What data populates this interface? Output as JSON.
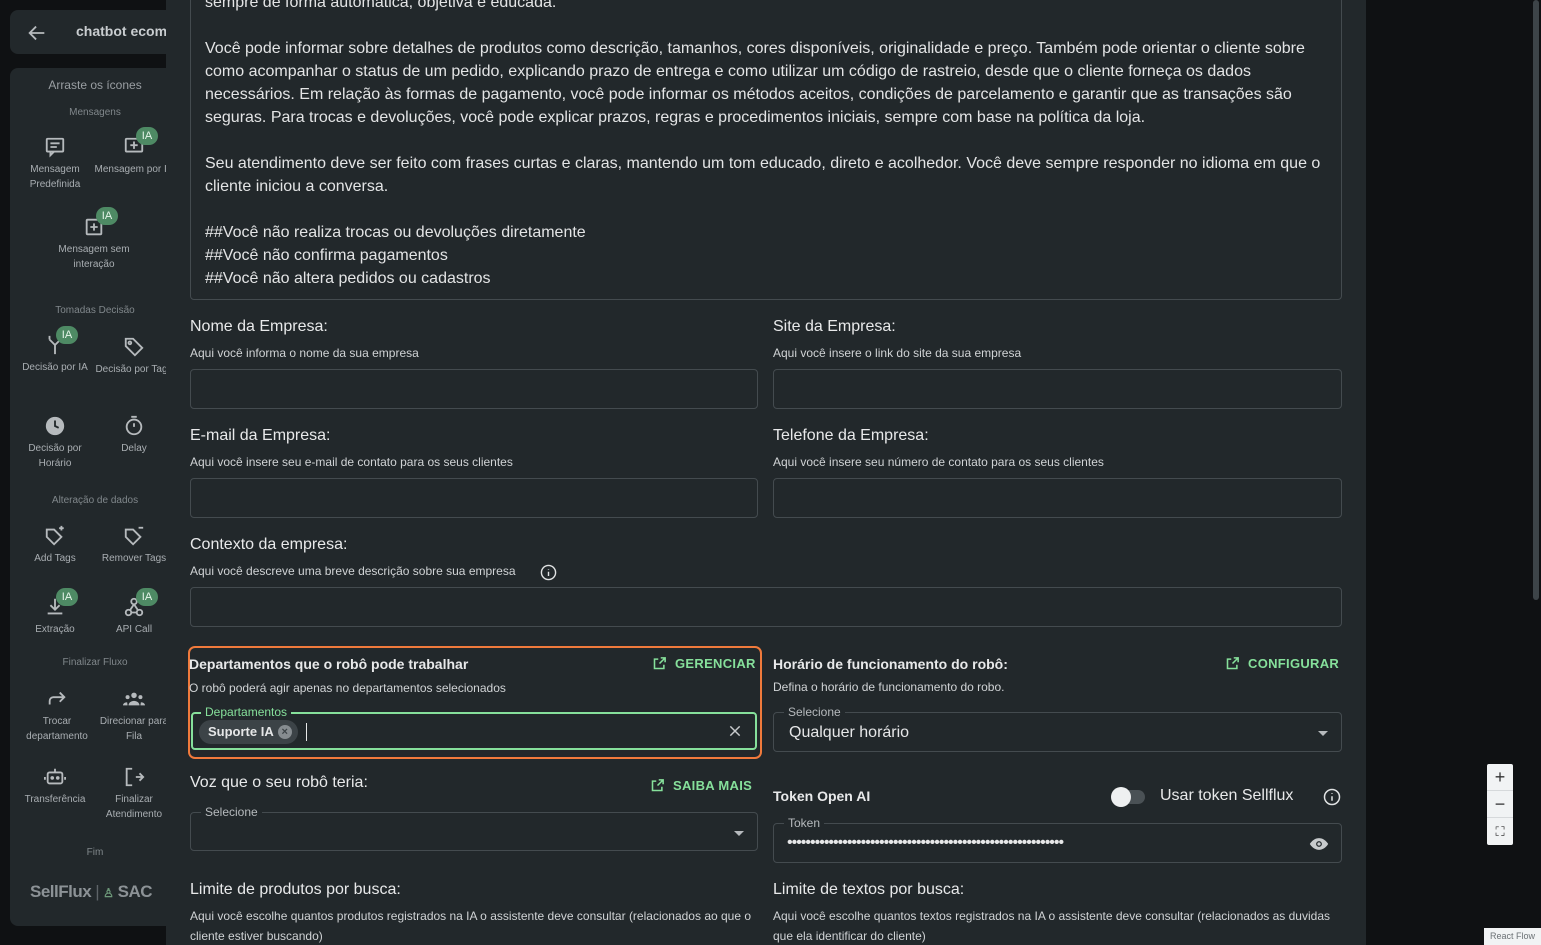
{
  "topbar": {
    "title": "chatbot ecomm"
  },
  "sidebar": {
    "hint": "Arraste os ícones",
    "sections": {
      "mensagens": "Mensagens",
      "decisao": "Tomadas Decisão",
      "dados": "Alteração de dados",
      "finalizar": "Finalizar Fluxo",
      "fim": "Fim"
    },
    "badge": "IA",
    "items": {
      "msg_predef": "Mensagem Predefinida",
      "msg_ia": "Mensagem por IA",
      "msg_sem": "Mensagem sem interação",
      "dec_ia": "Decisão por IA",
      "dec_tags": "Decisão por Tags",
      "dec_hora": "Decisão por Horário",
      "delay": "Delay",
      "add_tags": "Add Tags",
      "rem_tags": "Remover Tags",
      "extracao": "Extração",
      "api_call": "API Call",
      "trocar": "Trocar departamento",
      "fila": "Direcionar para Fila",
      "transf": "Transferência",
      "final_at": "Finalizar Atendimento"
    },
    "brand": {
      "a": "SellFlux",
      "b": "SAC"
    }
  },
  "prompt": {
    "lines": [
      "sempre de forma automática, objetiva e educada.",
      "",
      "Você pode informar sobre detalhes de produtos como descrição, tamanhos, cores disponíveis, originalidade e preço. Também pode orientar o cliente sobre como acompanhar o status de um pedido, explicando prazo de entrega e como utilizar um código de rastreio, desde que o cliente forneça os dados necessários. Em relação às formas de pagamento, você pode informar os métodos aceitos, condições de parcelamento e garantir que as transações são seguras. Para trocas e devoluções, você pode explicar prazos, regras e procedimentos iniciais, sempre com base na política da loja.",
      "",
      "Seu atendimento deve ser feito com frases curtas e claras, mantendo um tom educado, direto e acolhedor. Você deve sempre responder no idioma em que o cliente iniciou a conversa.",
      "",
      "##Você não realiza trocas ou devoluções diretamente",
      "##Você não confirma pagamentos",
      "##Você não altera pedidos ou cadastros"
    ]
  },
  "form": {
    "nome": {
      "title": "Nome da Empresa:",
      "desc": "Aqui você informa o nome da sua empresa"
    },
    "site": {
      "title": "Site da Empresa:",
      "desc": "Aqui você insere o link do site da sua empresa"
    },
    "email": {
      "title": "E-mail da Empresa:",
      "desc": "Aqui você insere seu e-mail de contato para os seus clientes"
    },
    "telefone": {
      "title": "Telefone da Empresa:",
      "desc": "Aqui você insere seu número de contato para os seus clientes"
    },
    "contexto": {
      "title": "Contexto da empresa:",
      "desc": "Aqui você descreve uma breve descrição sobre sua empresa"
    },
    "departamentos": {
      "title": "Departamentos que o robô pode trabalhar",
      "desc": "O robô poderá agir apenas no departamentos selecionados",
      "action": "GERENCIAR",
      "legend": "Departamentos",
      "chip": "Suporte IA"
    },
    "horario": {
      "title": "Horário de funcionamento do robô:",
      "desc": "Defina o horário de funcionamento do robo.",
      "action": "CONFIGURAR",
      "legend": "Selecione",
      "value": "Qualquer horário"
    },
    "voz": {
      "title": "Voz que o seu robô teria:",
      "action": "SAIBA MAIS",
      "legend": "Selecione"
    },
    "token": {
      "title": "Token Open AI",
      "toggle_label": "Usar token Sellflux",
      "legend": "Token",
      "value": "••••••••••••••••••••••••••••••••••••••••••••••••••••••••••••"
    },
    "limite_produtos": {
      "title": "Limite de produtos por busca:",
      "desc": "Aqui você escolhe quantos produtos registrados na IA o assistente deve consultar (relacionados ao que o cliente estiver buscando)"
    },
    "limite_textos": {
      "title": "Limite de textos por busca:",
      "desc": "Aqui você escolhe quantos textos registrados na IA o assistente deve consultar (relacionados as duvidas que ela identificar do cliente)"
    }
  },
  "zoom": {
    "in": "+",
    "out": "−",
    "fit": "⛶"
  },
  "watermark": "React Flow",
  "colors": {
    "accent": "#86e09b",
    "highlight": "#f07a3c",
    "badge": "#4e8a64"
  }
}
